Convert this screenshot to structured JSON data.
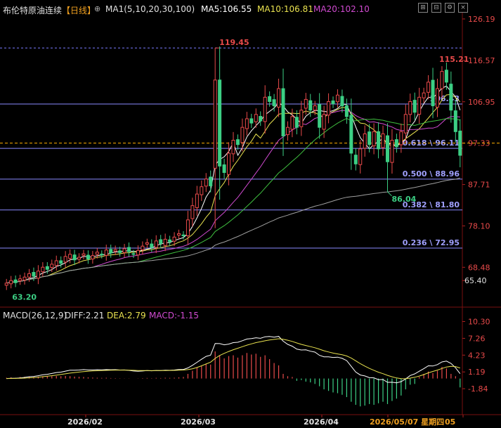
{
  "header": {
    "title": "布伦特原油连续",
    "period": "【日线】",
    "ma_label": "MA1(5,10,20,30,100)",
    "ma5": "MA5:106.55",
    "ma10": "MA10:106.81",
    "ma20": "MA20:102.10"
  },
  "macd_header": {
    "label": "MACD(26,12,9)",
    "diff": "DIFF:2.21",
    "dea": "DEA:2.79",
    "macd": "MACD:-1.15"
  },
  "colors": {
    "up": "#e84a4a",
    "down": "#3ccf84",
    "ma5": "#ffffff",
    "ma10": "#e9e24f",
    "ma20": "#d04ad0",
    "ma30": "#3fbf3f",
    "ma100": "#a0a0a0",
    "fib": "#8a8aff",
    "current_price": "#ffb000"
  },
  "chart_data": {
    "type": "candlestick",
    "price_axis_ticks": [
      "126.19",
      "116.57",
      "106.95",
      "97.33",
      "87.71",
      "78.10",
      "68.48",
      "65.40"
    ],
    "macd_axis_ticks": [
      "10.30",
      "7.26",
      "4.23",
      "1.19",
      "-1.84"
    ],
    "x_tick_labels": [
      "2026/02",
      "2026/03",
      "2026/04",
      "2026/05/07 星期四",
      "05"
    ],
    "price_range": [
      62,
      127
    ],
    "macd_range": [
      -4.5,
      11
    ],
    "high_label": "119.45",
    "low_label": "63.20",
    "dip_label": "86.04",
    "recent_high_label": "115.21",
    "current_price": 97.33,
    "fib_levels": [
      {
        "value": 106.43,
        "label": "106.43"
      },
      {
        "value": 96.11,
        "label": "0.618 \\ 96.11"
      },
      {
        "value": 88.96,
        "label": "0.500 \\ 88.96"
      },
      {
        "value": 81.8,
        "label": "0.382 \\ 81.80"
      },
      {
        "value": 72.95,
        "label": "0.236 \\ 72.95"
      }
    ],
    "closes": [
      64.8,
      65.4,
      64.9,
      65.8,
      66.2,
      67.0,
      66.4,
      67.6,
      68.5,
      68.0,
      69.2,
      70.0,
      69.4,
      71.0,
      71.5,
      70.2,
      70.8,
      71.6,
      70.4,
      71.2,
      72.0,
      71.4,
      72.5,
      71.8,
      72.6,
      71.9,
      72.8,
      72.1,
      71.5,
      72.4,
      73.4,
      74.2,
      73.1,
      74.6,
      74.0,
      75.0,
      74.4,
      75.5,
      76.3,
      75.8,
      79.5,
      82.8,
      85.5,
      87.2,
      89.0,
      87.4,
      112.0,
      92.0,
      90.5,
      95.0,
      98.0,
      97.0,
      101.0,
      103.0,
      102.0,
      104.0,
      102.5,
      108.0,
      107.0,
      106.0,
      110.0,
      99.0,
      101.0,
      103.5,
      101.0,
      105.0,
      107.5,
      105.0,
      106.0,
      101.0,
      104.0,
      107.0,
      106.5,
      108.5,
      106.0,
      103.5,
      95.0,
      92.5,
      96.0,
      99.5,
      97.0,
      100.0,
      96.0,
      99.5,
      93.0,
      98.0,
      96.5,
      100.0,
      104.0,
      107.0,
      104.5,
      108.0,
      109.0,
      111.5,
      106.0,
      110.0,
      114.0,
      111.5,
      105.0,
      100.0,
      94.5
    ],
    "macd_bars": [
      0.1,
      0.15,
      0.1,
      0.2,
      0.22,
      0.25,
      0.2,
      0.25,
      0.3,
      0.28,
      0.3,
      0.32,
      0.3,
      0.33,
      0.3,
      0.25,
      0.22,
      0.2,
      0.15,
      0.12,
      0.1,
      0.08,
      0.1,
      0.06,
      0.05,
      0.03,
      0.02,
      0.02,
      0.0,
      0.02,
      0.05,
      0.07,
      0.04,
      0.08,
      0.06,
      0.1,
      0.08,
      0.1,
      0.15,
      0.2,
      0.6,
      1.0,
      1.4,
      1.6,
      1.9,
      1.8,
      3.5,
      3.0,
      2.6,
      2.9,
      3.0,
      2.7,
      3.0,
      3.3,
      3.1,
      3.2,
      2.8,
      3.0,
      2.5,
      2.0,
      1.7,
      0.6,
      0.3,
      0.2,
      -0.3,
      -0.2,
      -0.4,
      -0.5,
      -0.7,
      -1.0,
      -1.4,
      -1.6,
      -1.8,
      -1.9,
      -2.1,
      -2.4,
      -3.0,
      -3.4,
      -3.6,
      -3.5,
      -3.3,
      -3.4,
      -3.2,
      -3.0,
      -3.3,
      -2.9,
      -2.6,
      -2.2,
      -1.4,
      -0.8,
      -0.7,
      0.2,
      0.6,
      0.9,
      0.7,
      1.0,
      1.5,
      1.3,
      0.6,
      0.3,
      -1.15
    ]
  }
}
